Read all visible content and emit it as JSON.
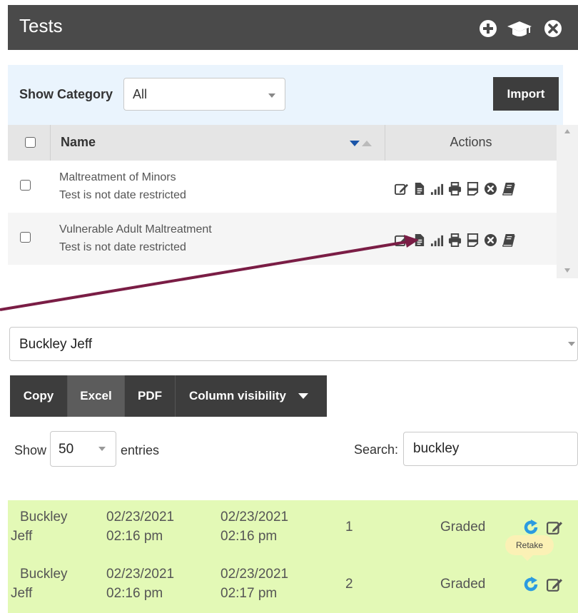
{
  "tests_panel": {
    "title": "Tests",
    "header_icons": [
      "plus-circle-icon",
      "graduation-cap-icon",
      "close-circle-icon"
    ]
  },
  "category": {
    "label": "Show Category",
    "selected": "All",
    "import_label": "Import"
  },
  "tests_table": {
    "headers": {
      "name": "Name",
      "actions": "Actions"
    },
    "rows": [
      {
        "name": "Maltreatment of Minors",
        "subtitle": "Test is not date restricted"
      },
      {
        "name": "Vulnerable Adult Maltreatment",
        "subtitle": "Test is not date restricted"
      }
    ],
    "action_icons": [
      "edit-icon",
      "document-icon",
      "bar-chart-icon",
      "print-icon",
      "answer-key-icon",
      "delete-icon",
      "book-icon"
    ]
  },
  "student_select": {
    "selected": "Buckley Jeff"
  },
  "export_buttons": {
    "copy": "Copy",
    "excel": "Excel",
    "pdf": "PDF",
    "column_visibility": "Column visibility"
  },
  "entries": {
    "show_label": "Show",
    "value": "50",
    "suffix_label": "entries"
  },
  "search": {
    "label": "Search:",
    "value": "buckley"
  },
  "results": {
    "rows": [
      {
        "last": "Buckley",
        "first": "Jeff",
        "start_date": "02/23/2021",
        "start_time": "02:16 pm",
        "end_date": "02/23/2021",
        "end_time": "02:16 pm",
        "attempt": "1",
        "status": "Graded"
      },
      {
        "last": "Buckley",
        "first": "Jeff",
        "start_date": "02/23/2021",
        "start_time": "02:16 pm",
        "end_date": "02/23/2021",
        "end_time": "02:17 pm",
        "attempt": "2",
        "status": "Graded"
      }
    ],
    "tooltip": "Retake",
    "row_icons": [
      "retake-icon",
      "edit-icon"
    ]
  },
  "colors": {
    "header_bg": "#4a4a4a",
    "category_bg": "#eaf4fd",
    "button_bg": "#3d3d3d",
    "row_highlight": "#e3f9b6",
    "arrow": "#7a1d45",
    "retake_blue": "#2b9be0"
  }
}
